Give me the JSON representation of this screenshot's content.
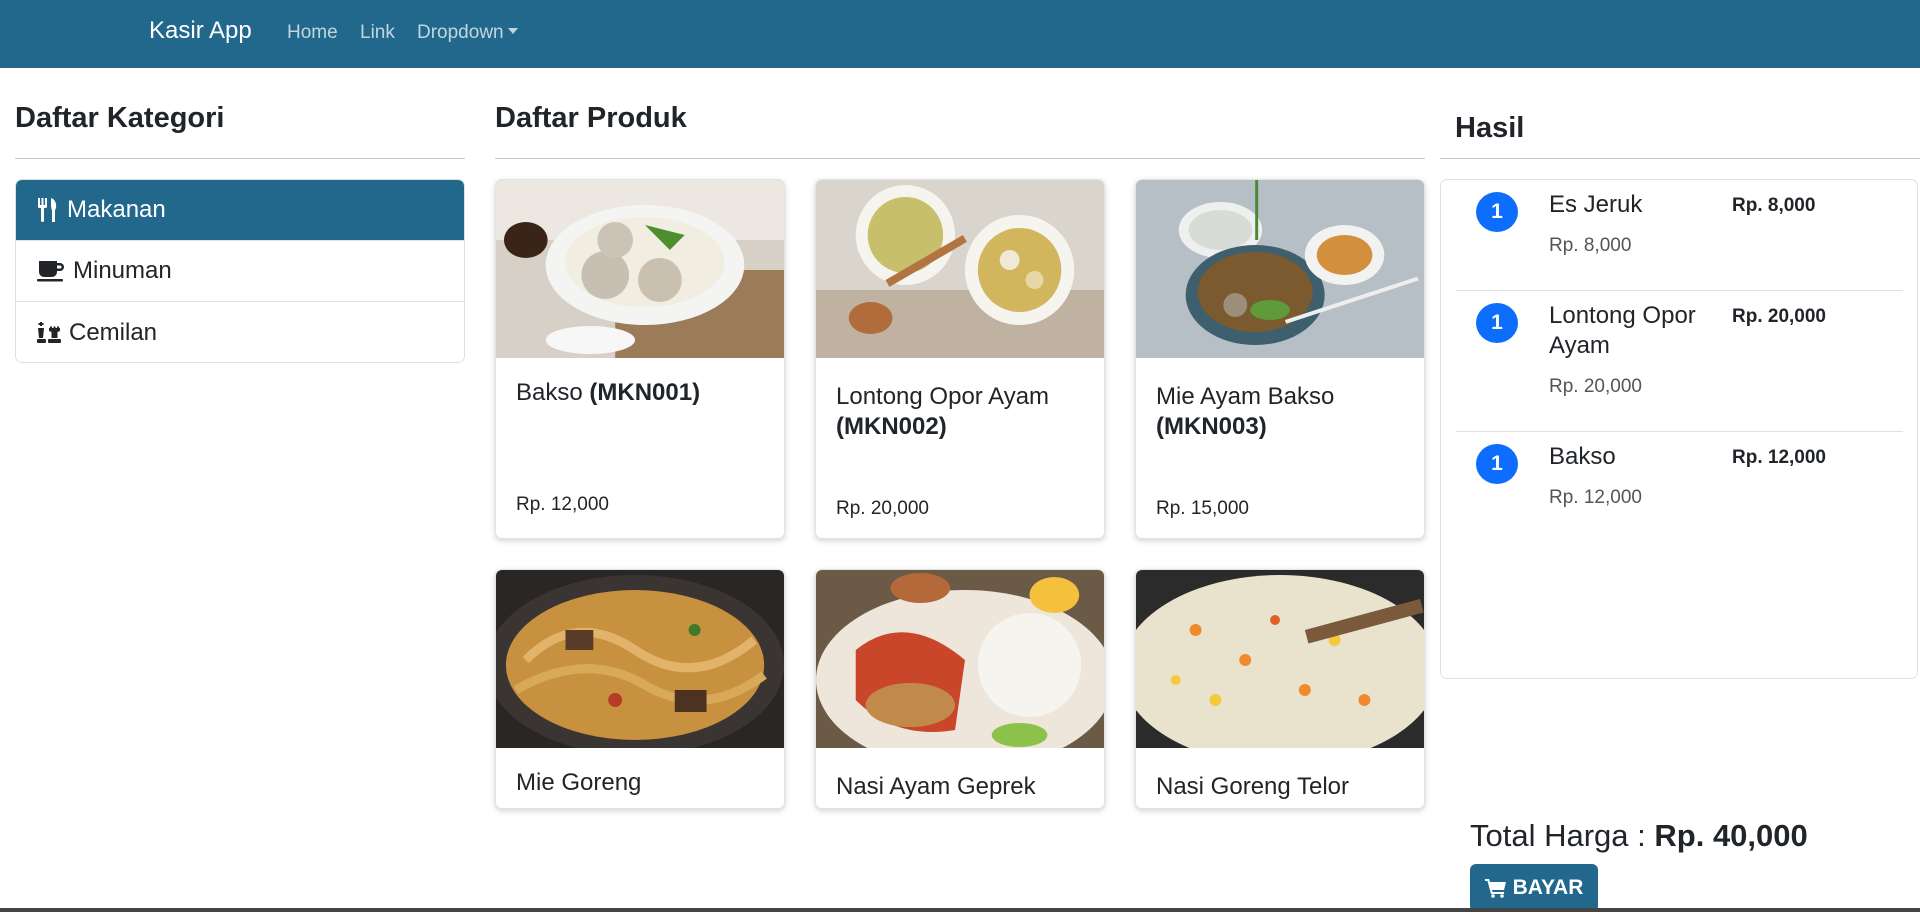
{
  "navbar": {
    "brand": "Kasir App",
    "links": [
      "Home",
      "Link",
      "Dropdown"
    ],
    "background": "#22688c"
  },
  "categories": {
    "title": "Daftar Kategori",
    "items": [
      {
        "label": "Makanan",
        "icon": "utensils-icon",
        "active": true
      },
      {
        "label": "Minuman",
        "icon": "coffee-icon",
        "active": false
      },
      {
        "label": "Cemilan",
        "icon": "chess-icon",
        "active": false
      }
    ]
  },
  "products": {
    "title": "Daftar Produk",
    "items": [
      {
        "name": "Bakso",
        "code": "(MKN001)",
        "price": "Rp. 12,000"
      },
      {
        "name": "Lontong Opor Ayam",
        "code": "(MKN002)",
        "price": "Rp. 20,000"
      },
      {
        "name": "Mie Ayam Bakso",
        "code": "(MKN003)",
        "price": "Rp. 15,000"
      },
      {
        "name": "Mie Goreng",
        "code": "",
        "price": ""
      },
      {
        "name": "Nasi Ayam Geprek",
        "code": "",
        "price": ""
      },
      {
        "name": "Nasi Goreng Telor",
        "code": "",
        "price": ""
      }
    ]
  },
  "result": {
    "title": "Hasil",
    "items": [
      {
        "qty": "1",
        "name": "Es Jeruk",
        "price": "Rp. 8,000",
        "total": "Rp. 8,000"
      },
      {
        "qty": "1",
        "name": "Lontong Opor Ayam",
        "price": "Rp. 20,000",
        "total": "Rp. 20,000"
      },
      {
        "qty": "1",
        "name": "Bakso",
        "price": "Rp. 12,000",
        "total": "Rp. 12,000"
      }
    ],
    "total_label": "Total Harga :",
    "total_value": "Rp. 40,000",
    "pay_label": "BAYAR",
    "badge_color": "#0d6efd"
  }
}
